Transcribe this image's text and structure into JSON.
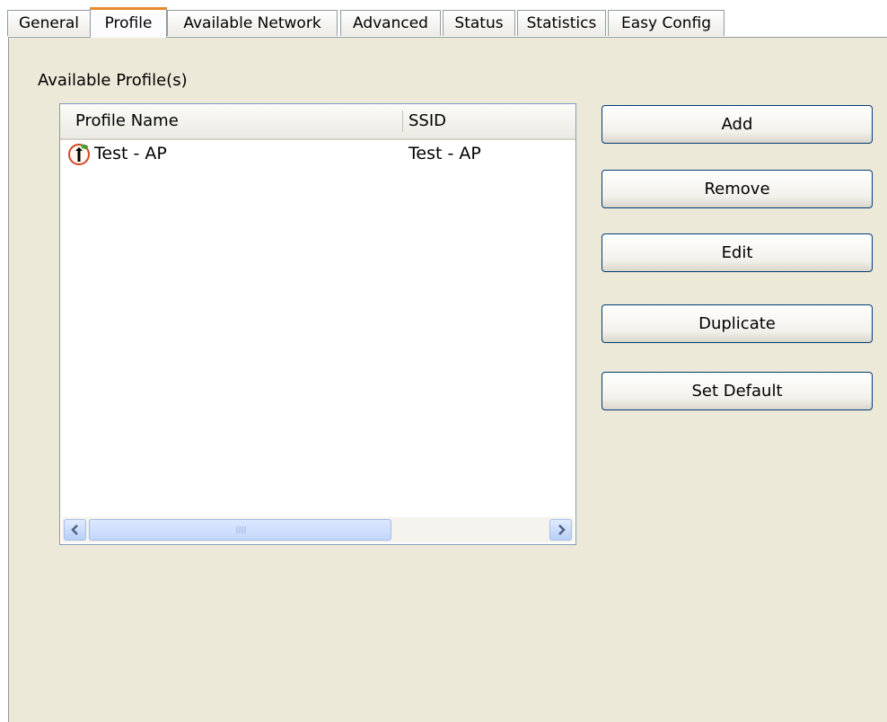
{
  "tabs": [
    {
      "label": "General",
      "active": false
    },
    {
      "label": "Profile",
      "active": true
    },
    {
      "label": "Available Network",
      "active": false
    },
    {
      "label": "Advanced",
      "active": false
    },
    {
      "label": "Status",
      "active": false
    },
    {
      "label": "Statistics",
      "active": false
    },
    {
      "label": "Easy Config",
      "active": false
    }
  ],
  "profiles": {
    "group_label": "Available Profile(s)",
    "columns": [
      "Profile Name",
      "SSID"
    ],
    "rows": [
      {
        "name": "Test - AP",
        "ssid": "Test - AP",
        "icon": "wireless-profile-icon"
      }
    ]
  },
  "buttons": {
    "add": "Add",
    "remove": "Remove",
    "edit": "Edit",
    "duplicate": "Duplicate",
    "set_default": "Set Default"
  },
  "colors": {
    "panel_bg": "#ece9d8",
    "active_tab_accent": "#e68b2c",
    "button_border": "#003c74",
    "list_border": "#7f9db9"
  }
}
